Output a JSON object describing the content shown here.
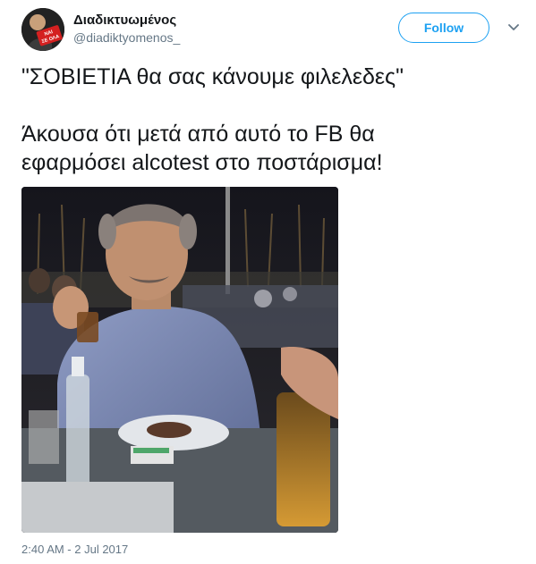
{
  "author": {
    "display_name": "Διαδικτυωμένος",
    "handle": "@diadiktyomenos_",
    "avatar_text": "ΝΑΙ ΣΕ ΟΛΑ"
  },
  "actions": {
    "follow_label": "Follow"
  },
  "tweet": {
    "line1": "\"ΣΟΒΙΕΤΙΑ θα σας κάνουμε φιλελεδες\"",
    "line2": "Άκουσα ότι μετά από αυτό το FB θα",
    "line3": "εφαρμόσει alcotest στο ποστάρισμα!"
  },
  "timestamp": "2:40 AM - 2 Jul 2017",
  "colors": {
    "accent": "#1da1f2",
    "text": "#14171a",
    "muted": "#657786"
  },
  "icons": {
    "caret": "chevron-down-icon"
  }
}
